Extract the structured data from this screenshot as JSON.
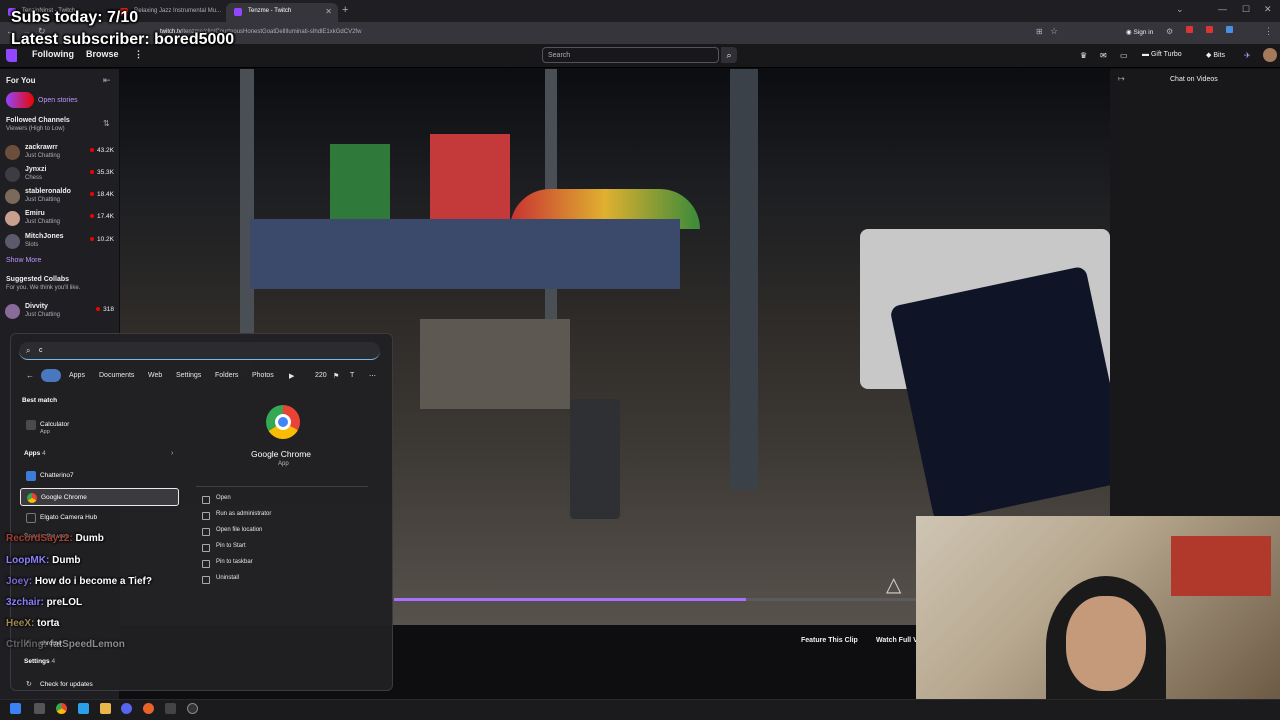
{
  "browser": {
    "tabs": [
      {
        "label": "TenzinNinst - Twitch",
        "active": false
      },
      {
        "label": "Relaxing Jazz Instrumental Mu...",
        "active": false
      },
      {
        "label": "Tenzme - Twitch",
        "active": true
      }
    ],
    "url_prefix": "twitch.tv",
    "url_rest": "/tenzme/clip/CourteousHonestGoatDellIluminati-sIhdlE1xkGdCV2fw",
    "sign_in_label": "Sign in"
  },
  "overlay": {
    "subs_today": "Subs today: 7/10",
    "latest_subscriber": "Latest subscriber: bored5000"
  },
  "nav": {
    "following": "Following",
    "browse": "Browse",
    "more": "⋮",
    "search_placeholder": "Search",
    "get_turbo": "Gift Turbo",
    "bits": "Bits"
  },
  "sidebar": {
    "for_you": "For You",
    "open_stories": "Open stories",
    "followed_channels": "Followed Channels",
    "sort_label": "Viewers (High to Low)",
    "channels": [
      {
        "name": "zackrawrr",
        "game": "Just Chatting",
        "viewers": "43.2K"
      },
      {
        "name": "Jynxzi",
        "game": "Chess",
        "viewers": "35.3K"
      },
      {
        "name": "stableronaldo",
        "game": "Just Chatting",
        "viewers": "18.4K"
      },
      {
        "name": "Emiru",
        "game": "Just Chatting",
        "viewers": "17.4K"
      },
      {
        "name": "MitchJones",
        "game": "Slots",
        "viewers": "10.2K"
      }
    ],
    "show_more": "Show More",
    "suggested_collabs": "Suggested Collabs",
    "suggested_sub": "For you. We think you'll like.",
    "suggested": [
      {
        "name": "Divvity",
        "game": "Just Chatting",
        "viewers": "318"
      }
    ]
  },
  "video": {
    "progress": 0.674,
    "feature_clip": "Feature This Clip",
    "watch_full": "Watch Full V"
  },
  "chat_panel": {
    "title": "Chat on Videos"
  },
  "start_menu": {
    "query": "c",
    "tabs": [
      "Apps",
      "Documents",
      "Web",
      "Settings",
      "Folders",
      "Photos"
    ],
    "tab_extra": [
      "220",
      "T"
    ],
    "best_match_label": "Best match",
    "best_match": {
      "name": "Calculator",
      "type": "App"
    },
    "apps_label": "Apps",
    "apps_count": "4",
    "apps": [
      "Chatterino7",
      "Google Chrome",
      "Elgato Camera Hub"
    ],
    "search_web_label": "Search the web",
    "web_results": [
      "chrome"
    ],
    "settings_label": "Settings",
    "settings_count": "4",
    "settings_items": [
      "Check for updates"
    ],
    "preview": {
      "name": "Google Chrome",
      "type": "App",
      "actions": [
        "Open",
        "Run as administrator",
        "Open file location",
        "Pin to Start",
        "Pin to taskbar",
        "Uninstall"
      ]
    }
  },
  "chat_overlay": [
    {
      "user": "RecordSay12:",
      "msg": "Dumb"
    },
    {
      "user": "LoopMK:",
      "msg": "Dumb"
    },
    {
      "user": "Joey:",
      "msg": "How do i become a Tief?"
    },
    {
      "user": "3zchair:",
      "msg": "preLOL"
    },
    {
      "user": "HeeX:",
      "msg": "torta"
    },
    {
      "user": "Ctrlking:",
      "msg": "fatSpeedLemon"
    }
  ]
}
